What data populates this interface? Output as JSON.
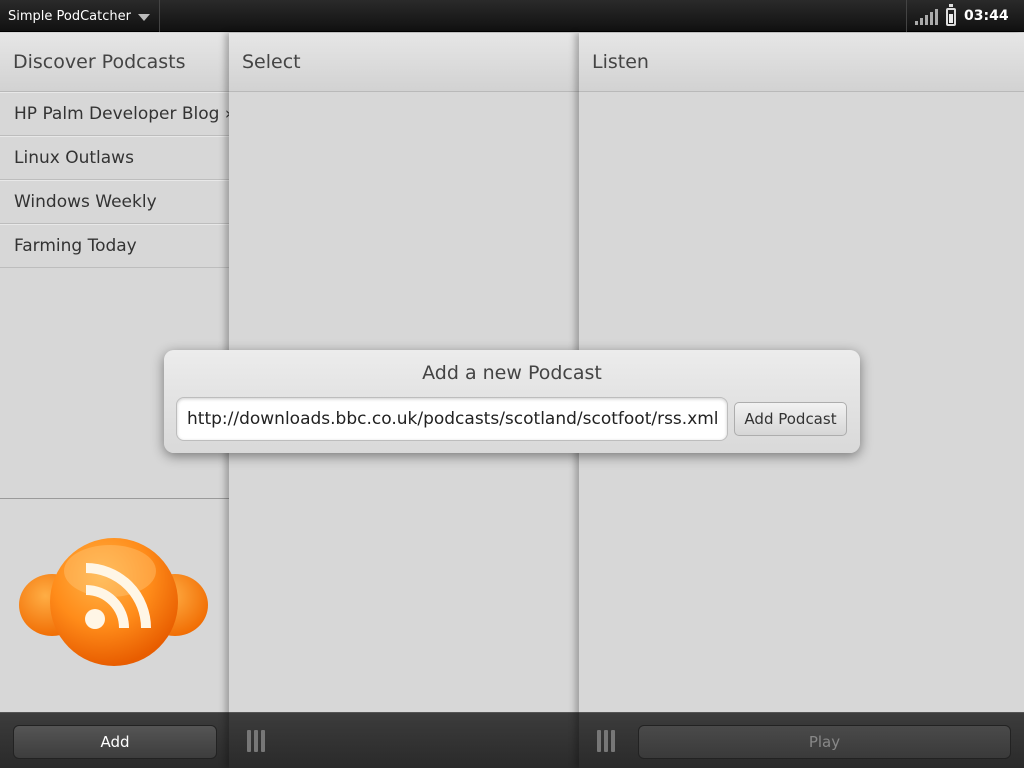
{
  "status_bar": {
    "app_name": "Simple PodCatcher",
    "time": "03:44"
  },
  "discover_pane": {
    "title": "Discover Podcasts",
    "podcasts": [
      "HP Palm Developer Blog » I",
      "Linux Outlaws",
      "Windows Weekly",
      "Farming Today"
    ],
    "add_label": "Add"
  },
  "select_pane": {
    "title": "Select"
  },
  "listen_pane": {
    "title": "Listen",
    "play_label": "Play"
  },
  "dialog": {
    "title": "Add a new Podcast",
    "url_value": "http://downloads.bbc.co.uk/podcasts/scotland/scotfoot/rss.xml",
    "button_label": "Add Podcast"
  },
  "colors": {
    "rss_orange": "#ff8c1a",
    "rss_orange_dark": "#f06a00"
  }
}
